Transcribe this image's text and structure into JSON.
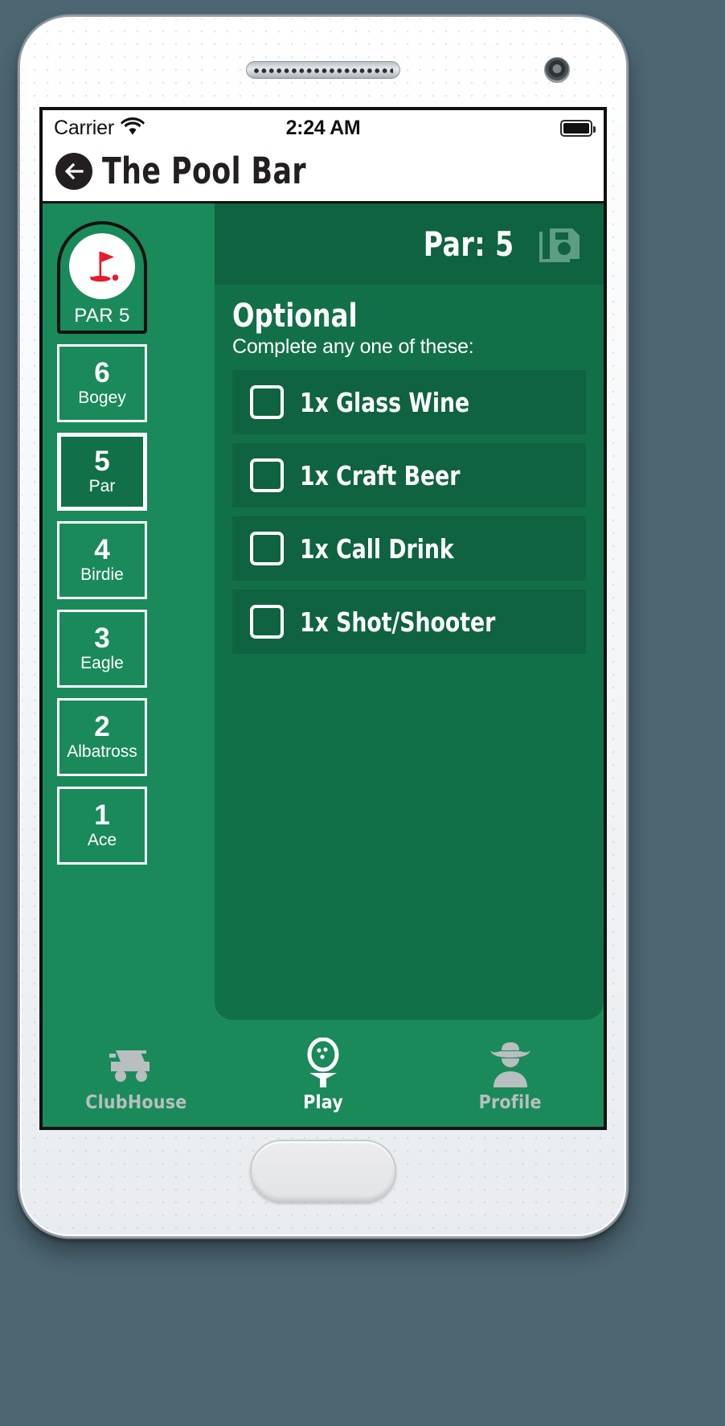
{
  "device": {
    "frame": "white-smartphone",
    "speaker": "earpiece-speaker",
    "camera": "front-camera",
    "home_button": "home-button"
  },
  "statusbar": {
    "carrier": "Carrier",
    "wifi_icon": "wifi-icon",
    "time": "2:24 AM",
    "battery_icon": "battery-full-icon"
  },
  "navbar": {
    "back_icon": "arrow-left-circle-icon",
    "title": "The Pool Bar"
  },
  "sidebar": {
    "badge": {
      "icon": "golf-flag-icon",
      "label": "PAR 5"
    },
    "scores": [
      {
        "num": "6",
        "label": "Bogey",
        "selected": false
      },
      {
        "num": "5",
        "label": "Par",
        "selected": true
      },
      {
        "num": "4",
        "label": "Birdie",
        "selected": false
      },
      {
        "num": "3",
        "label": "Eagle",
        "selected": false
      },
      {
        "num": "2",
        "label": "Albatross",
        "selected": false
      },
      {
        "num": "1",
        "label": "Ace",
        "selected": false
      }
    ]
  },
  "panel": {
    "par_title": "Par: 5",
    "save_icon": "save-floppy-icon",
    "section_title": "Optional",
    "section_subtitle": "Complete any one of these:",
    "tasks": [
      {
        "label": "1x Glass Wine",
        "checked": false
      },
      {
        "label": "1x Craft Beer",
        "checked": false
      },
      {
        "label": "1x Call Drink",
        "checked": false
      },
      {
        "label": "1x Shot/Shooter",
        "checked": false
      }
    ]
  },
  "tabbar": {
    "tabs": [
      {
        "label": "ClubHouse",
        "icon": "golf-cart-icon",
        "active": false
      },
      {
        "label": "Play",
        "icon": "golf-ball-tee-icon",
        "active": true
      },
      {
        "label": "Profile",
        "icon": "cowboy-person-icon",
        "active": false
      }
    ]
  },
  "colors": {
    "brand_green": "#1a8a5a",
    "panel_green": "#127048",
    "row_green": "#0f6340",
    "flag_red": "#e8192c",
    "white": "#ffffff",
    "inactive_gray": "#b9bec1"
  }
}
